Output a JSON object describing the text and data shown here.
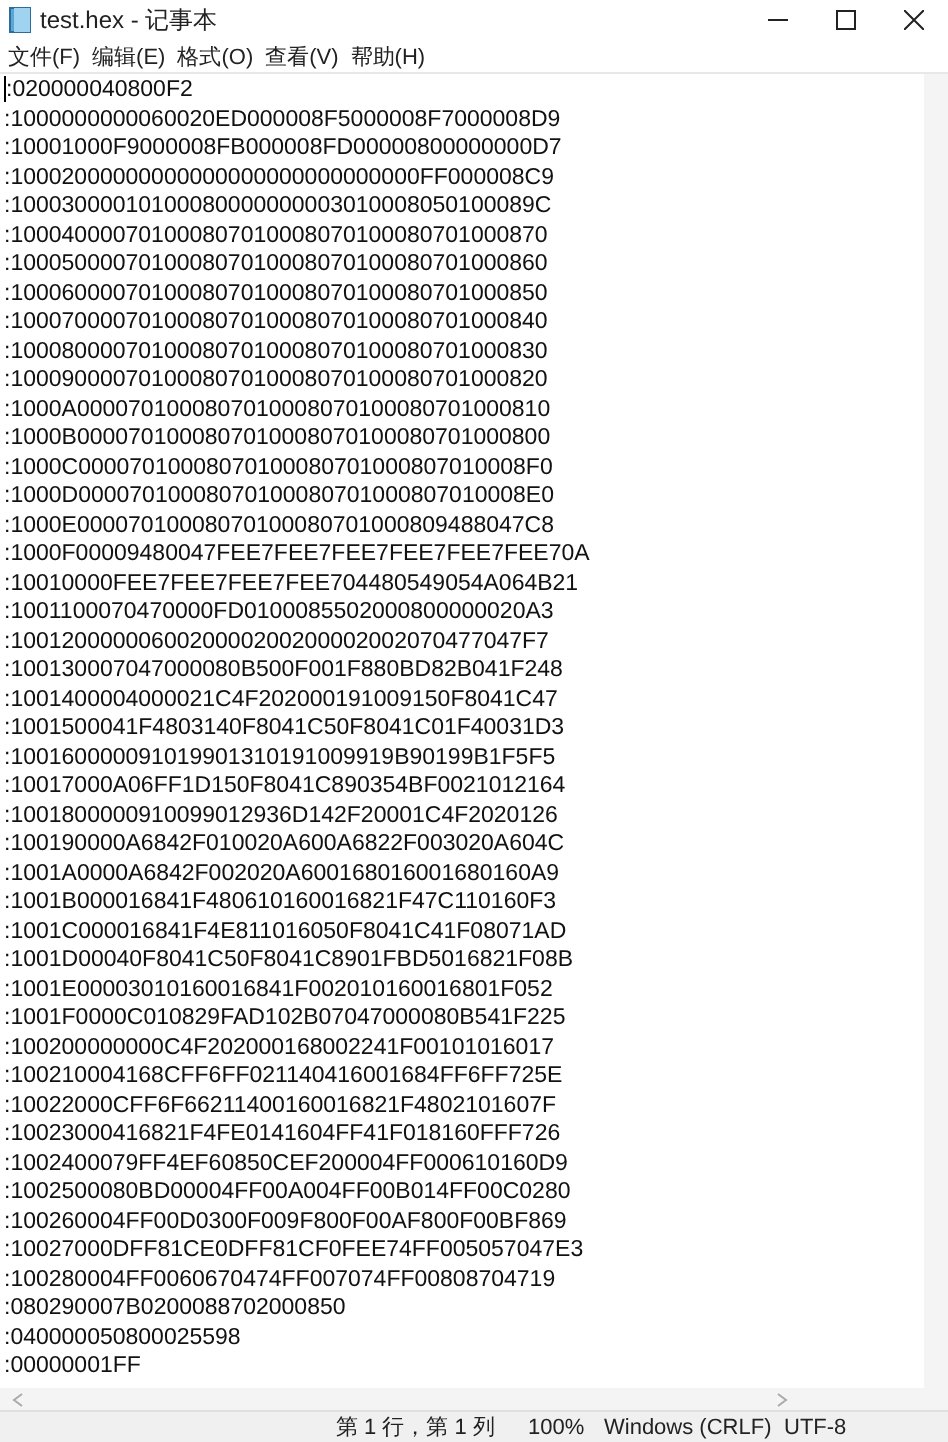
{
  "window": {
    "title": "test.hex - 记事本"
  },
  "menu": [
    {
      "label": "文件(F)"
    },
    {
      "label": "编辑(E)"
    },
    {
      "label": "格式(O)"
    },
    {
      "label": "查看(V)"
    },
    {
      "label": "帮助(H)"
    }
  ],
  "lines": [
    ":020000040800F2",
    ":1000000000060020ED000008F5000008F7000008D9",
    ":10001000F9000008FB000008FD00000800000000D7",
    ":10002000000000000000000000000000FF000008C9",
    ":10003000010100080000000003010008050100089C",
    ":100040000701000807010008070100080701000870",
    ":100050000701000807010008070100080701000860",
    ":100060000701000807010008070100080701000850",
    ":100070000701000807010008070100080701000840",
    ":100080000701000807010008070100080701000830",
    ":100090000701000807010008070100080701000820",
    ":1000A0000701000807010008070100080701000810",
    ":1000B0000701000807010008070100080701000800",
    ":1000C00007010008070100080701000807010008F0",
    ":1000D00007010008070100080701000807010008E0",
    ":1000E00007010008070100080701000809488047C8",
    ":1000F00009480047FEE7FEE7FEE7FEE7FEE7FEE70A",
    ":10010000FEE7FEE7FEE7FEE704480549054A064B21",
    ":1001100070470000FD0100085502000800000020A3",
    ":1001200000060020000200200002002070477047F7",
    ":100130007047000080B500F001F880BD82B041F248",
    ":1001400004000021C4F202000191009150F8041C47",
    ":1001500041F4803140F8041C50F8041C01F40031D3",
    ":100160000091019901310191009919B90199B1F5F5",
    ":10017000A06FF1D150F8041C890354BF0021012164",
    ":1001800000910099012936D142F20001C4F2020126",
    ":100190000A6842F010020A600A6822F003020A604C",
    ":1001A0000A6842F002020A600168016001680160A9",
    ":1001B000016841F480610160016821F47C110160F3",
    ":1001C000016841F4E811016050F8041C41F08071AD",
    ":1001D00040F8041C50F8041C8901FBD5016821F08B",
    ":1001E00003010160016841F002010160016801F052",
    ":1001F0000C010829FAD102B07047000080B541F225",
    ":100200000000C4F202000168002241F00101016017",
    ":100210004168CFF6FF021140416001684FF6FF725E",
    ":10022000CFF6F66211400160016821F4802101607F",
    ":10023000416821F4FE0141604FF41F018160FFF726",
    ":1002400079FF4EF60850CEF200004FF000610160D9",
    ":1002500080BD00004FF00A004FF00B014FF00C0280",
    ":100260004FF00D0300F009F800F00AF800F00BF869",
    ":10027000DFF81CE0DFF81CF0FEE74FF005057047E3",
    ":100280004FF0060670474FF007074FF00808704719",
    ":080290007B0200088702000850",
    ":040000050800025598",
    ":00000001FF"
  ],
  "status_bar": [
    {
      "text": "第 1 行，第 1 列"
    },
    {
      "text": "100%"
    },
    {
      "text": "Windows (CRLF)"
    },
    {
      "text": "UTF-8"
    }
  ]
}
